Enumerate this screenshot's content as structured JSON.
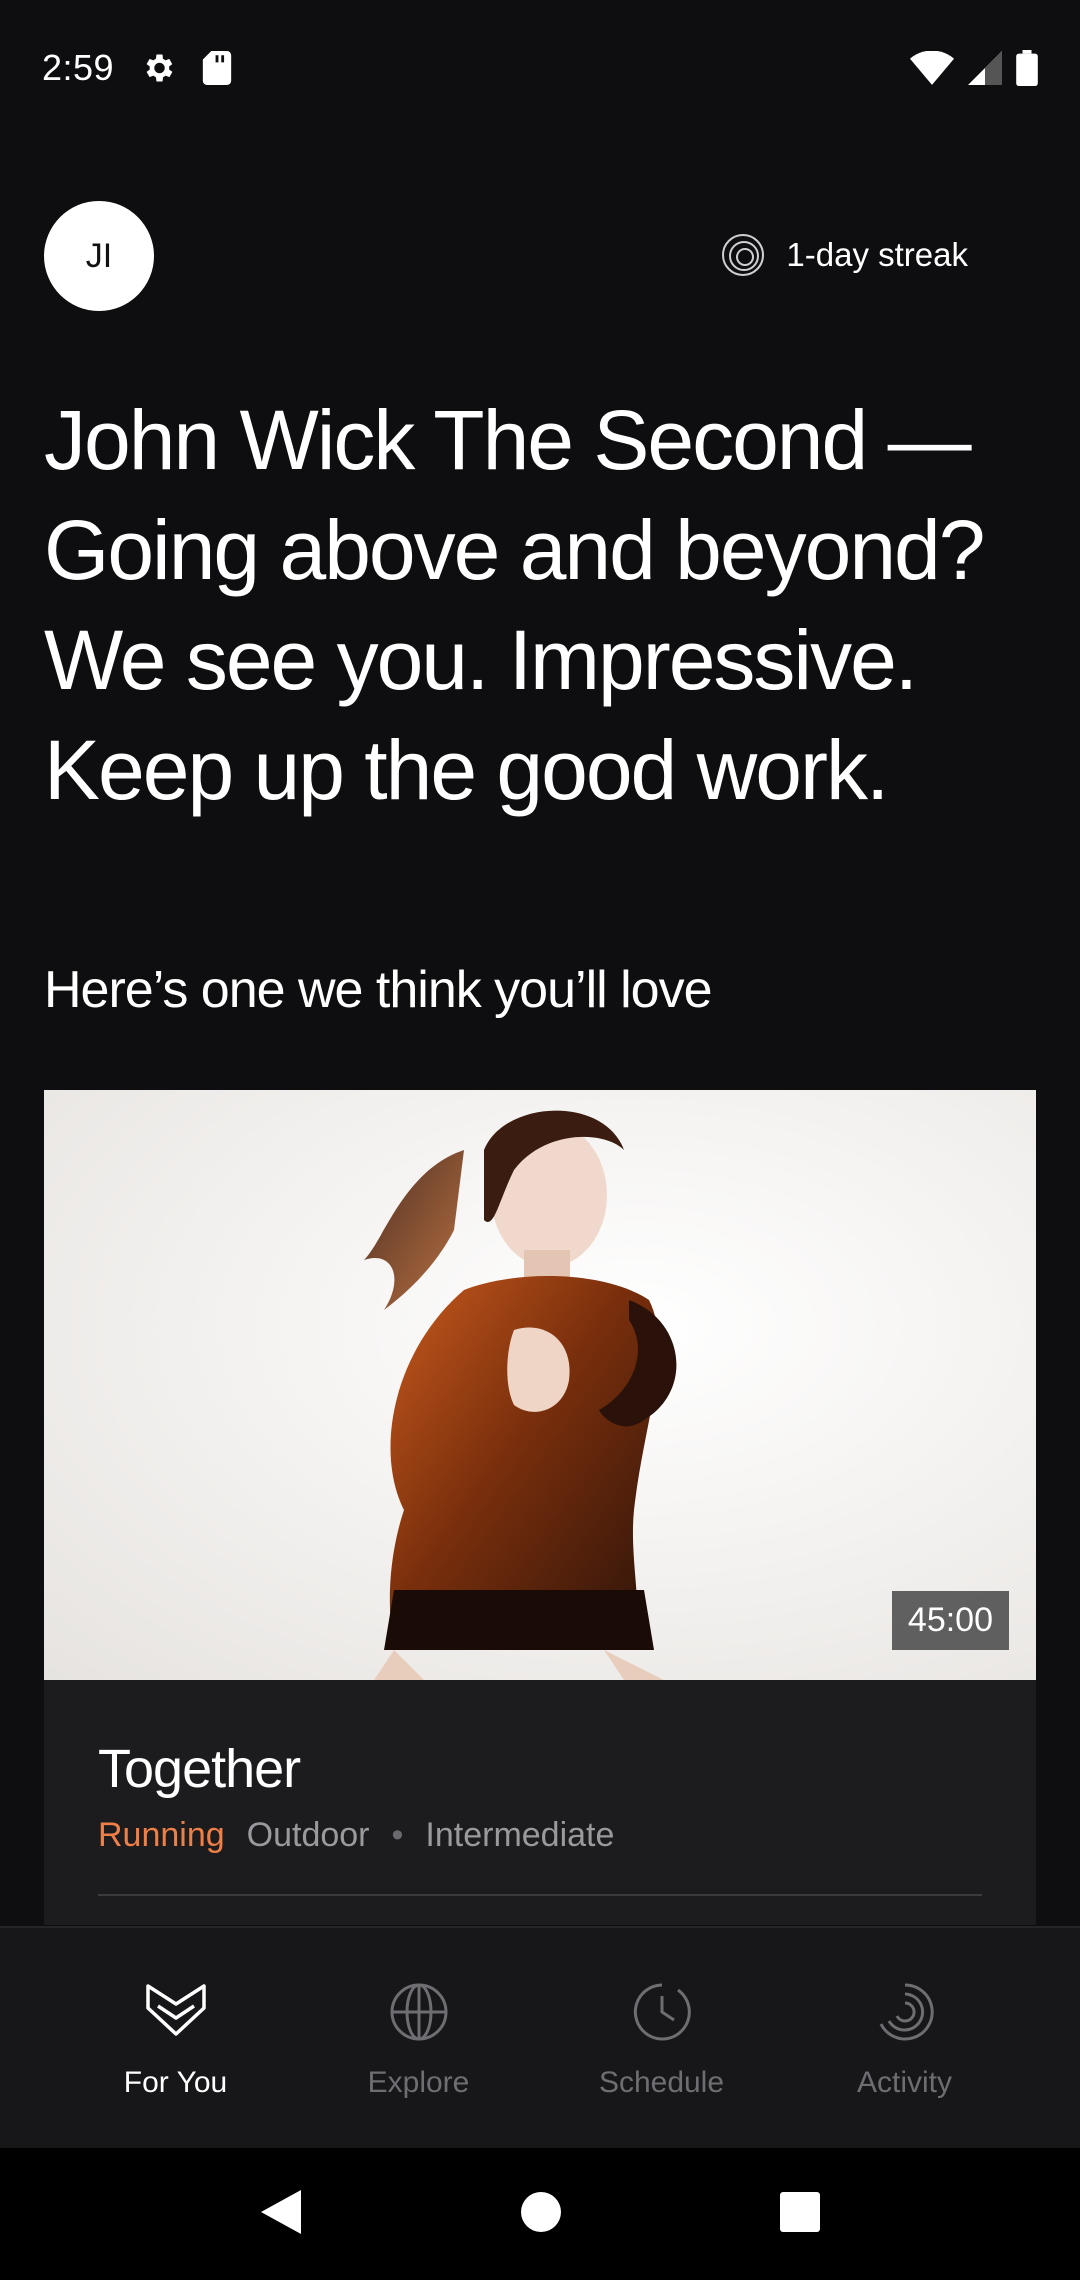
{
  "status_bar": {
    "time": "2:59",
    "icons": [
      "gear-icon",
      "sd-card-icon",
      "wifi-icon",
      "signal-icon",
      "battery-icon"
    ]
  },
  "header": {
    "avatar_initials": "JI",
    "streak_text": "1-day streak",
    "streak_icon": "streak-rings-icon"
  },
  "headline": "John Wick The Second — Going above and beyond? We see you. Impressive. Keep up the good work.",
  "section_title": "Here’s one we think you’ll love",
  "card": {
    "duration": "45:00",
    "title": "Together",
    "category": "Running",
    "location": "Outdoor",
    "separator": "•",
    "level": "Intermediate",
    "accent_color": "#ee7f47"
  },
  "bottom_nav": {
    "items": [
      {
        "label": "For You",
        "icon": "heart-chevron-icon",
        "active": true
      },
      {
        "label": "Explore",
        "icon": "globe-icon",
        "active": false
      },
      {
        "label": "Schedule",
        "icon": "clock-icon",
        "active": false
      },
      {
        "label": "Activity",
        "icon": "activity-rings-icon",
        "active": false
      }
    ]
  },
  "system_nav": {
    "icons": [
      "back-icon",
      "home-icon",
      "recents-icon"
    ]
  }
}
